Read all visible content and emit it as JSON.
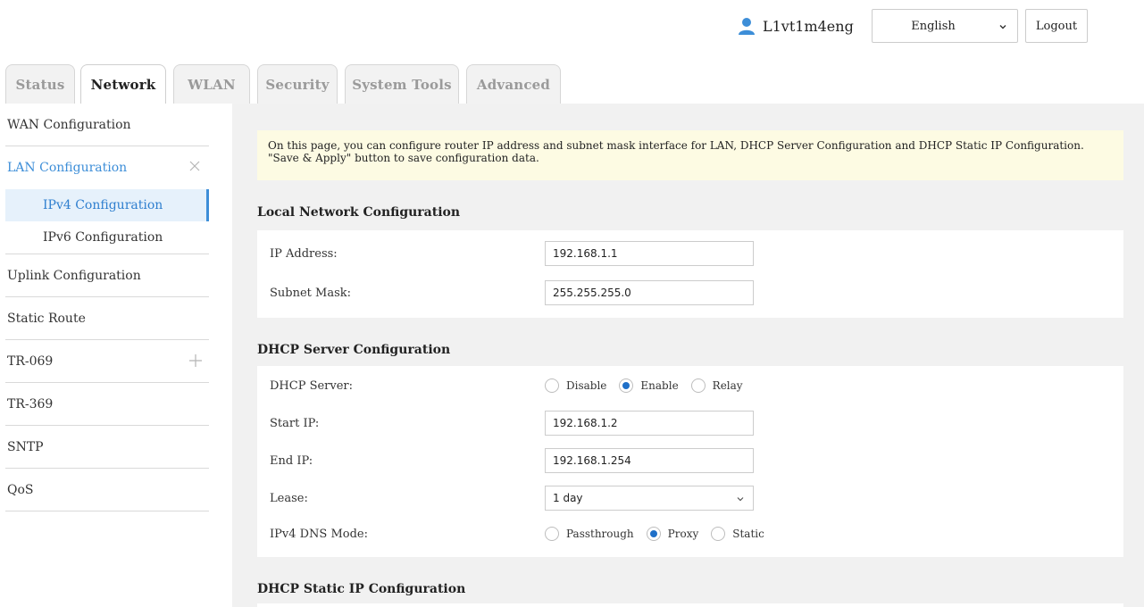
{
  "header": {
    "username": "L1vt1m4eng",
    "language": "English",
    "logout_label": "Logout",
    "accent": "#3d8ed8"
  },
  "tabs": [
    {
      "label": "Status",
      "active": false
    },
    {
      "label": "Network",
      "active": true
    },
    {
      "label": "WLAN",
      "active": false
    },
    {
      "label": "Security",
      "active": false
    },
    {
      "label": "System Tools",
      "active": false
    },
    {
      "label": "Advanced",
      "active": false
    }
  ],
  "sidebar": {
    "items": [
      {
        "label": "WAN Configuration"
      },
      {
        "label": "LAN Configuration",
        "children": [
          {
            "label": "IPv4 Configuration",
            "active": true
          },
          {
            "label": "IPv6 Configuration",
            "active": false
          }
        ]
      },
      {
        "label": "Uplink Configuration"
      },
      {
        "label": "Static Route"
      },
      {
        "label": "TR-069"
      },
      {
        "label": "TR-369"
      },
      {
        "label": "SNTP"
      },
      {
        "label": "QoS"
      }
    ]
  },
  "main": {
    "info": "On this page, you can configure router IP address and subnet mask interface for LAN, DHCP Server Configuration and DHCP Static IP Configuration. \"Save & Apply\" button to save configuration data.",
    "local": {
      "title": "Local Network Configuration",
      "ip_label": "IP Address:",
      "ip_value": "192.168.1.1",
      "mask_label": "Subnet Mask:",
      "mask_value": "255.255.255.0"
    },
    "dhcp": {
      "title": "DHCP Server Configuration",
      "server_label": "DHCP Server:",
      "server_options": [
        "Disable",
        "Enable",
        "Relay"
      ],
      "server_selected": "Enable",
      "start_label": "Start IP:",
      "start_value": "192.168.1.2",
      "end_label": "End IP:",
      "end_value": "192.168.1.254",
      "lease_label": "Lease:",
      "lease_value": "1 day",
      "dns_label": "IPv4 DNS Mode:",
      "dns_options": [
        "Passthrough",
        "Proxy",
        "Static"
      ],
      "dns_selected": "Proxy"
    },
    "static": {
      "title": "DHCP Static IP Configuration"
    }
  }
}
